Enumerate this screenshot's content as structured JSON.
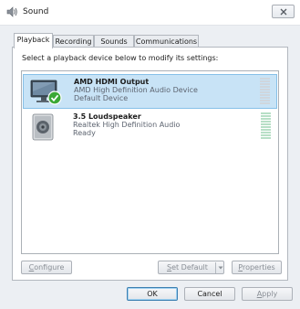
{
  "window": {
    "title": "Sound"
  },
  "tabs": [
    {
      "label": "Playback",
      "active": true
    },
    {
      "label": "Recording",
      "active": false
    },
    {
      "label": "Sounds",
      "active": false
    },
    {
      "label": "Communications",
      "active": false
    }
  ],
  "panel": {
    "instruction": "Select a playback device below to modify its settings:"
  },
  "devices": [
    {
      "name": "AMD HDMI Output",
      "description": "AMD High Definition Audio Device",
      "status": "Default Device",
      "selected": true,
      "icon": "monitor-icon",
      "badge": "default-check-icon"
    },
    {
      "name": "3.5 Loudspeaker",
      "description": "Realtek High Definition Audio",
      "status": "Ready",
      "selected": false,
      "icon": "speaker-icon"
    }
  ],
  "panel_buttons": {
    "configure": {
      "hotkey": "C",
      "rest": "onfigure"
    },
    "set_default": {
      "hotkey": "S",
      "rest": "et Default"
    },
    "properties": {
      "hotkey": "P",
      "rest": "roperties"
    }
  },
  "dialog_buttons": {
    "ok": "OK",
    "cancel": "Cancel",
    "apply": {
      "hotkey": "A",
      "rest": "pply"
    }
  },
  "colors": {
    "selection_bg": "#c8e3f6",
    "selection_border": "#86c0e8",
    "check_green": "#3aa835",
    "meter_bar": "#cfd6dd"
  }
}
